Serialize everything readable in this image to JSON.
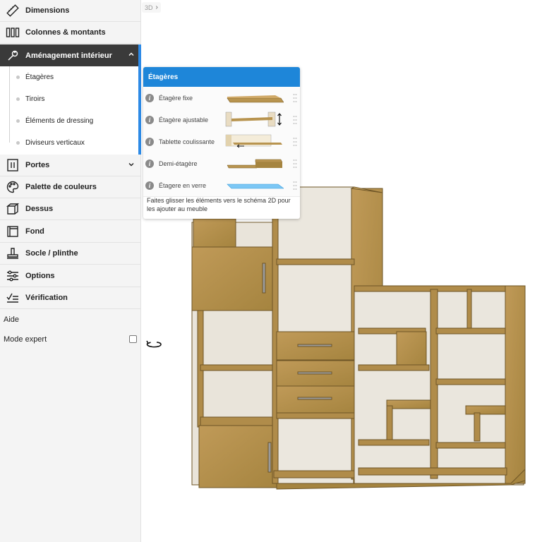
{
  "sidebar": {
    "items": [
      {
        "label": "Dimensions",
        "icon": "ruler-icon"
      },
      {
        "label": "Colonnes & montants",
        "icon": "columns-icon"
      },
      {
        "label": "Aménagement intérieur",
        "icon": "wrench-icon"
      },
      {
        "label": "Portes",
        "icon": "door-icon"
      },
      {
        "label": "Palette de couleurs",
        "icon": "palette-icon"
      },
      {
        "label": "Dessus",
        "icon": "box-top-icon"
      },
      {
        "label": "Fond",
        "icon": "back-panel-icon"
      },
      {
        "label": "Socle / plinthe",
        "icon": "plinth-icon"
      },
      {
        "label": "Options",
        "icon": "sliders-icon"
      },
      {
        "label": "Vérification",
        "icon": "check-list-icon"
      }
    ],
    "subitems": [
      "Étagères",
      "Tiroirs",
      "Éléments de dressing",
      "Diviseurs verticaux"
    ],
    "help_label": "Aide",
    "expert_label": "Mode expert",
    "expert_checked": false
  },
  "view": {
    "mode_label": "3D"
  },
  "panel": {
    "title": "Étagères",
    "rows": [
      {
        "label": "Étagère fixe",
        "thumb": "fixed-shelf"
      },
      {
        "label": "Étagère ajustable",
        "thumb": "adjustable-shelf"
      },
      {
        "label": "Tablette coulissante",
        "thumb": "sliding-shelf"
      },
      {
        "label": "Demi-étagère",
        "thumb": "half-shelf"
      },
      {
        "label": "Étagere en verre",
        "thumb": "glass-shelf"
      }
    ],
    "hint": "Faites glisser les éléments vers le schéma 2D pour les ajouter au meuble"
  },
  "colors": {
    "accent": "#1e86d9",
    "active_bg": "#3a3a3a",
    "wood": "#b8944f",
    "glass": "#7cc7f5"
  }
}
